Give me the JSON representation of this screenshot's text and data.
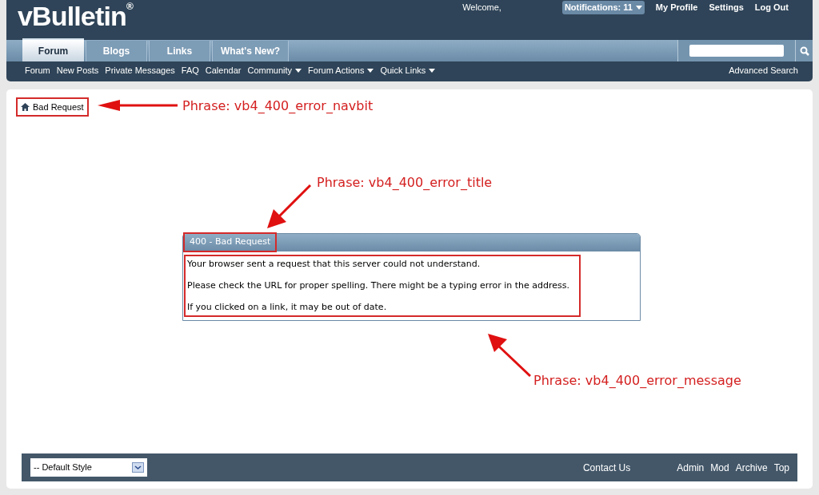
{
  "header": {
    "logo": "vBulletin",
    "logo_mark": "®",
    "welcome": "Welcome,",
    "notifications": "Notifications: 11",
    "links": [
      "My Profile",
      "Settings",
      "Log Out"
    ]
  },
  "tabs": [
    {
      "label": "Forum",
      "selected": true
    },
    {
      "label": "Blogs",
      "selected": false
    },
    {
      "label": "Links",
      "selected": false
    },
    {
      "label": "What's New?",
      "selected": false
    }
  ],
  "subnav": [
    {
      "label": "Forum",
      "has_menu": false
    },
    {
      "label": "New Posts",
      "has_menu": false
    },
    {
      "label": "Private Messages",
      "has_menu": false
    },
    {
      "label": "FAQ",
      "has_menu": false
    },
    {
      "label": "Calendar",
      "has_menu": false
    },
    {
      "label": "Community",
      "has_menu": true
    },
    {
      "label": "Forum Actions",
      "has_menu": true
    },
    {
      "label": "Quick Links",
      "has_menu": true
    }
  ],
  "advanced_search": "Advanced Search",
  "breadcrumb": "Bad Request",
  "error": {
    "title": "400 - Bad Request",
    "messages": [
      "Your browser sent a request that this server could not understand.",
      "Please check the URL for proper spelling. There might be a typing error in the address.",
      "If you clicked on a link, it may be out of date."
    ]
  },
  "annotations": [
    "Phrase: vb4_400_error_navbit",
    "Phrase: vb4_400_error_title",
    "Phrase: vb4_400_error_message"
  ],
  "footer": {
    "style_select": "-- Default Style",
    "contact": "Contact Us",
    "links": [
      "Admin",
      "Mod",
      "Archive",
      "Top"
    ]
  }
}
